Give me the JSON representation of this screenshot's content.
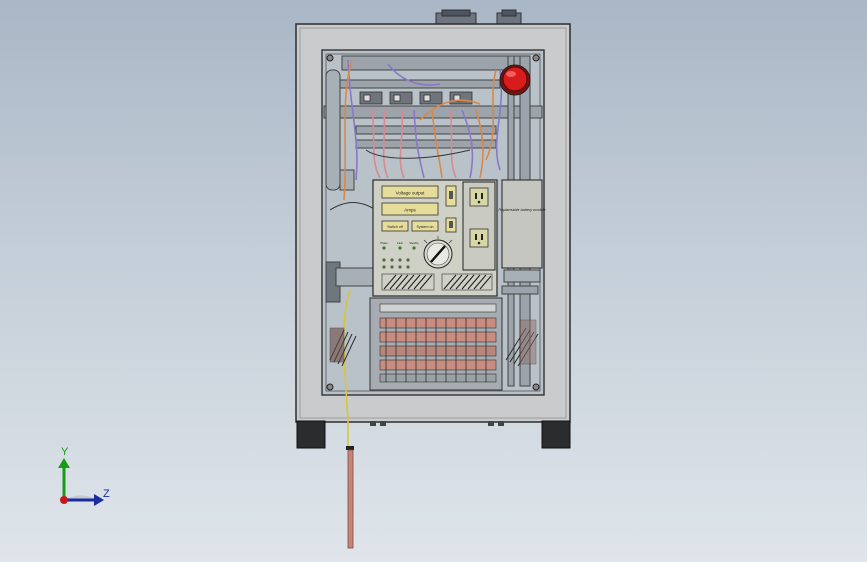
{
  "panel": {
    "readout_voltage": "Voltage output",
    "readout_amps": "Amps",
    "btn_left": "Switch off",
    "btn_right": "System on",
    "led_labels": [
      "Phase",
      "Fault",
      "Standby"
    ]
  },
  "battery_module_label": "Replaceable battery module",
  "triad": {
    "y": "Y",
    "z": "Z"
  },
  "colors": {
    "cabinet": "#c9cbcd",
    "window": "#b9c2c9",
    "panel": "#cfd1c6",
    "readout": "#e6dd9a",
    "estop": "#d81c1c",
    "wire_purple": "#8878c8",
    "wire_orange": "#d8894a",
    "wire_pink": "#d98a8e",
    "wire_yellow": "#d8c53a",
    "cable": "#c98477"
  }
}
